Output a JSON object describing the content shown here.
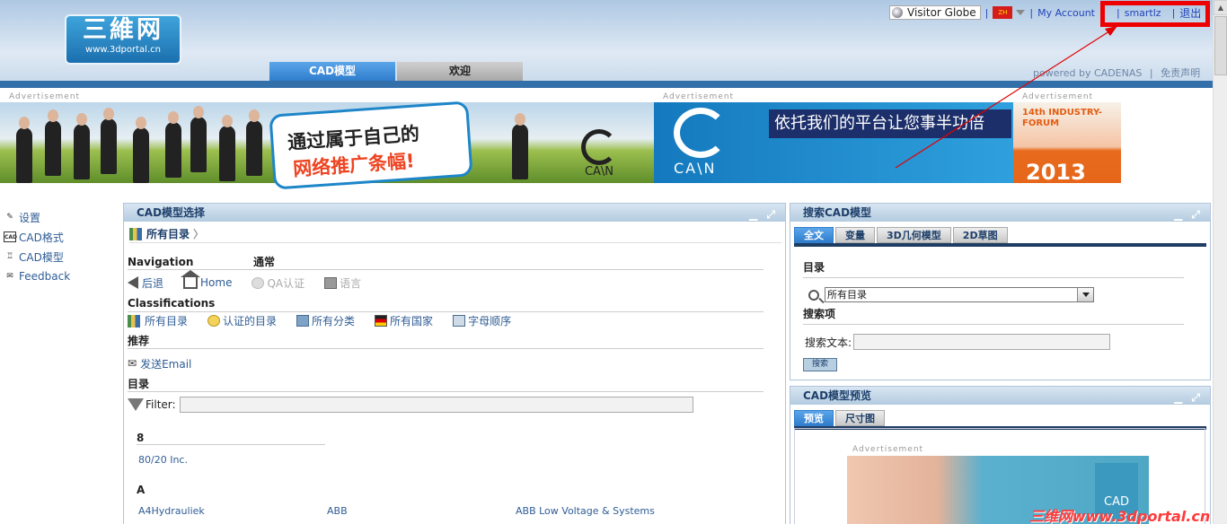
{
  "header": {
    "logo_title": "三維网",
    "logo_url": "www.3dportal.cn",
    "visitor_globe": "Visitor Globe",
    "lang_badge": "ZH",
    "my_account": "My Account",
    "user": "smartlz",
    "logout": "退出",
    "tab_cad": "CAD模型",
    "tab_welcome": "欢迎",
    "powered": "powered by CADENAS",
    "disclaimer": "免责声明",
    "sep": "|"
  },
  "ads": {
    "label": "Advertisement",
    "banner1_line1": "通过属于自己的",
    "banner1_line2": "网络推广条幅!",
    "banner1_brand": "CA\\N",
    "banner2_text": "依托我们的平台让您事半功倍",
    "banner2_brand": "CA\\N",
    "banner3_title": "14th INDUSTRY-FORUM",
    "banner3_year": "2013"
  },
  "leftnav": {
    "items": [
      {
        "label": "设置",
        "icon": "pencil-icon"
      },
      {
        "label": "CAD格式",
        "icon": "cad-icon"
      },
      {
        "label": "CAD模型",
        "icon": "tree-icon"
      },
      {
        "label": "Feedback",
        "icon": "mail-icon"
      }
    ]
  },
  "selection": {
    "title": "CAD模型选择",
    "breadcrumb": "所有目录",
    "nav_heading": "Navigation",
    "general_heading": "通常",
    "back": "后退",
    "home": "Home",
    "qa": "QA认证",
    "language": "语言",
    "classifications_heading": "Classifications",
    "all_catalogs": "所有目录",
    "certified_catalogs": "认证的目录",
    "all_categories": "所有分类",
    "all_countries": "所有国家",
    "alphabetical": "字母顺序",
    "recommend_heading": "推荐",
    "send_email": "发送Email",
    "catalog_heading": "目录",
    "filter_label": "Filter:",
    "groups": [
      {
        "letter": "8",
        "items": [
          "80/20 Inc."
        ]
      },
      {
        "letter": "A",
        "items": [
          "A4Hydrauliek",
          "ABB",
          "ABB Low Voltage & Systems"
        ]
      }
    ]
  },
  "search": {
    "title": "搜索CAD模型",
    "tabs": [
      "全文",
      "变量",
      "3D几何模型",
      "2D草图"
    ],
    "catalog_label": "目录",
    "catalog_value": "所有目录",
    "terms_label": "搜索项",
    "text_label": "搜索文本:",
    "text_value": "",
    "button": "搜索"
  },
  "preview": {
    "title": "CAD模型预览",
    "tabs": [
      "预览",
      "尺寸图"
    ],
    "ad_label": "Advertisement",
    "ad_brand": "CAD"
  },
  "watermark": "三维网www.3dportal.cn",
  "colors": {
    "accent": "#2f7dcc",
    "annotation": "#ee0000"
  }
}
